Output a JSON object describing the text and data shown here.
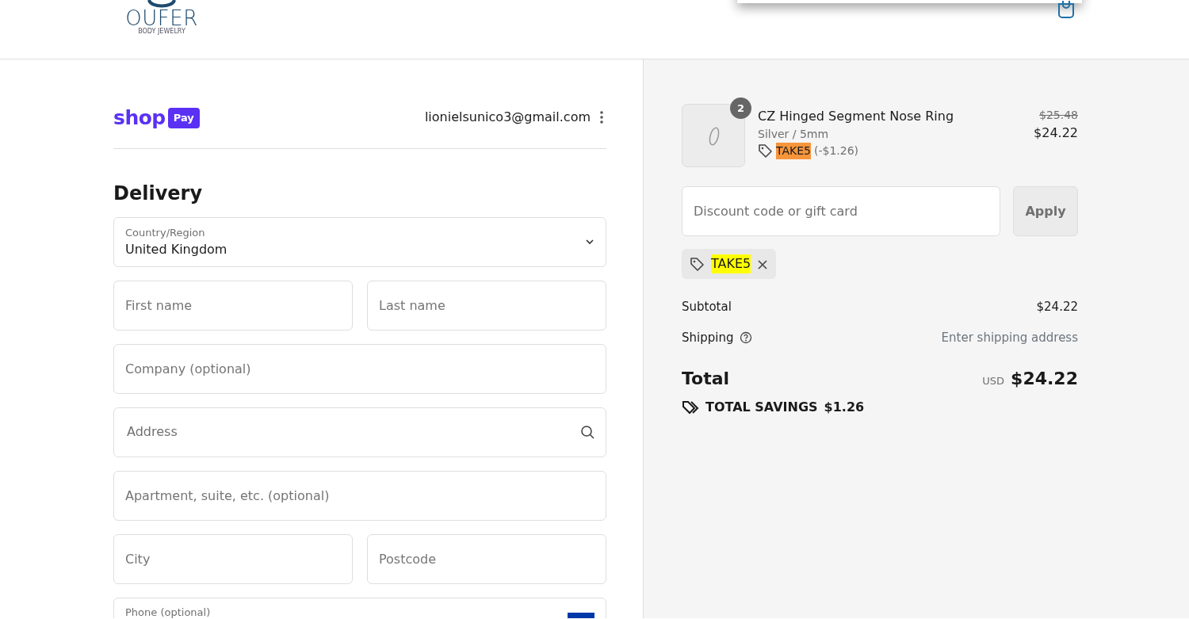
{
  "header": {
    "logo": {
      "name": "OUFER",
      "tagline": "BODY JEWELRY"
    }
  },
  "account": {
    "wordmark": "shop",
    "wallet": "Pay",
    "email": "lionielsunico3@gmail.com"
  },
  "delivery": {
    "heading": "Delivery",
    "rows": [
      [
        {
          "kind": "select",
          "label": "Country/Region",
          "value": "United Kingdom"
        }
      ],
      [
        {
          "kind": "text",
          "placeholder": "First name"
        },
        {
          "kind": "text",
          "placeholder": "Last name"
        }
      ],
      [
        {
          "kind": "text",
          "placeholder": "Company (optional)"
        }
      ],
      [
        {
          "kind": "search",
          "placeholder": "Address"
        }
      ],
      [
        {
          "kind": "text",
          "placeholder": "Apartment, suite, etc. (optional)"
        }
      ],
      [
        {
          "kind": "text",
          "placeholder": "City"
        },
        {
          "kind": "text",
          "placeholder": "Postcode"
        }
      ],
      [
        {
          "kind": "phone",
          "label": "Phone (optional)"
        }
      ]
    ]
  },
  "summary": {
    "items": [
      {
        "quantity": "2",
        "name": "CZ Hinged Segment Nose Ring",
        "variant": "Silver / 5mm",
        "discount_code": "TAKE5",
        "discount_amount": "(-$1.26)",
        "original_price": "$25.48",
        "price": "$24.22"
      }
    ],
    "discount_field": {
      "placeholder": "Discount code or gift card",
      "button": "Apply"
    },
    "applied_codes": [
      "TAKE5"
    ],
    "lines": [
      {
        "kind": "plain",
        "label": "Subtotal",
        "value": "$24.22"
      },
      {
        "kind": "help",
        "label": "Shipping",
        "value": "Enter shipping address"
      }
    ],
    "total": {
      "label": "Total",
      "currency": "USD",
      "value": "$24.22"
    },
    "savings": {
      "label": "TOTAL SAVINGS",
      "value": "$1.26"
    }
  }
}
